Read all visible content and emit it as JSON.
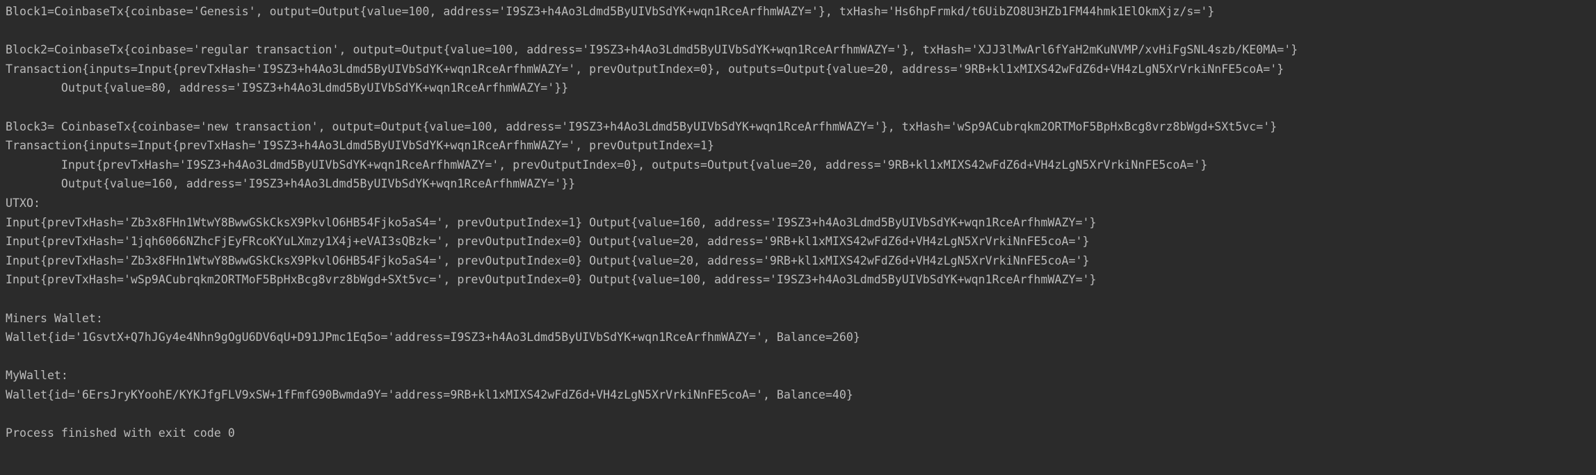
{
  "console": {
    "lines": [
      "Block1=CoinbaseTx{coinbase='Genesis', output=Output{value=100, address='I9SZ3+h4Ao3Ldmd5ByUIVbSdYK+wqn1RceArfhmWAZY='}, txHash='Hs6hpFrmkd/t6UibZO8U3HZb1FM44hmk1ElOkmXjz/s='}",
      "",
      "Block2=CoinbaseTx{coinbase='regular transaction', output=Output{value=100, address='I9SZ3+h4Ao3Ldmd5ByUIVbSdYK+wqn1RceArfhmWAZY='}, txHash='XJJ3lMwArl6fYaH2mKuNVMP/xvHiFgSNL4szb/KE0MA='}",
      "Transaction{inputs=Input{prevTxHash='I9SZ3+h4Ao3Ldmd5ByUIVbSdYK+wqn1RceArfhmWAZY=', prevOutputIndex=0}, outputs=Output{value=20, address='9RB+kl1xMIXS42wFdZ6d+VH4zLgN5XrVrkiNnFE5coA='}",
      "        Output{value=80, address='I9SZ3+h4Ao3Ldmd5ByUIVbSdYK+wqn1RceArfhmWAZY='}}",
      "",
      "Block3= CoinbaseTx{coinbase='new transaction', output=Output{value=100, address='I9SZ3+h4Ao3Ldmd5ByUIVbSdYK+wqn1RceArfhmWAZY='}, txHash='wSp9ACubrqkm2ORTMoF5BpHxBcg8vrz8bWgd+SXt5vc='}",
      "Transaction{inputs=Input{prevTxHash='I9SZ3+h4Ao3Ldmd5ByUIVbSdYK+wqn1RceArfhmWAZY=', prevOutputIndex=1}",
      "        Input{prevTxHash='I9SZ3+h4Ao3Ldmd5ByUIVbSdYK+wqn1RceArfhmWAZY=', prevOutputIndex=0}, outputs=Output{value=20, address='9RB+kl1xMIXS42wFdZ6d+VH4zLgN5XrVrkiNnFE5coA='}",
      "        Output{value=160, address='I9SZ3+h4Ao3Ldmd5ByUIVbSdYK+wqn1RceArfhmWAZY='}}",
      "UTXO:",
      "Input{prevTxHash='Zb3x8FHn1WtwY8BwwGSkCksX9PkvlO6HB54Fjko5aS4=', prevOutputIndex=1} Output{value=160, address='I9SZ3+h4Ao3Ldmd5ByUIVbSdYK+wqn1RceArfhmWAZY='}",
      "Input{prevTxHash='1jqh6066NZhcFjEyFRcoKYuLXmzy1X4j+eVAI3sQBzk=', prevOutputIndex=0} Output{value=20, address='9RB+kl1xMIXS42wFdZ6d+VH4zLgN5XrVrkiNnFE5coA='}",
      "Input{prevTxHash='Zb3x8FHn1WtwY8BwwGSkCksX9PkvlO6HB54Fjko5aS4=', prevOutputIndex=0} Output{value=20, address='9RB+kl1xMIXS42wFdZ6d+VH4zLgN5XrVrkiNnFE5coA='}",
      "Input{prevTxHash='wSp9ACubrqkm2ORTMoF5BpHxBcg8vrz8bWgd+SXt5vc=', prevOutputIndex=0} Output{value=100, address='I9SZ3+h4Ao3Ldmd5ByUIVbSdYK+wqn1RceArfhmWAZY='}",
      "",
      "Miners Wallet:",
      "Wallet{id='1GsvtX+Q7hJGy4e4Nhn9gOgU6DV6qU+D91JPmc1Eq5o='address=I9SZ3+h4Ao3Ldmd5ByUIVbSdYK+wqn1RceArfhmWAZY=', Balance=260}",
      "",
      "MyWallet:",
      "Wallet{id='6ErsJryKYoohE/KYKJfgFLV9xSW+1fFmfG90Bwmda9Y='address=9RB+kl1xMIXS42wFdZ6d+VH4zLgN5XrVrkiNnFE5coA=', Balance=40}",
      "",
      "Process finished with exit code 0"
    ]
  }
}
